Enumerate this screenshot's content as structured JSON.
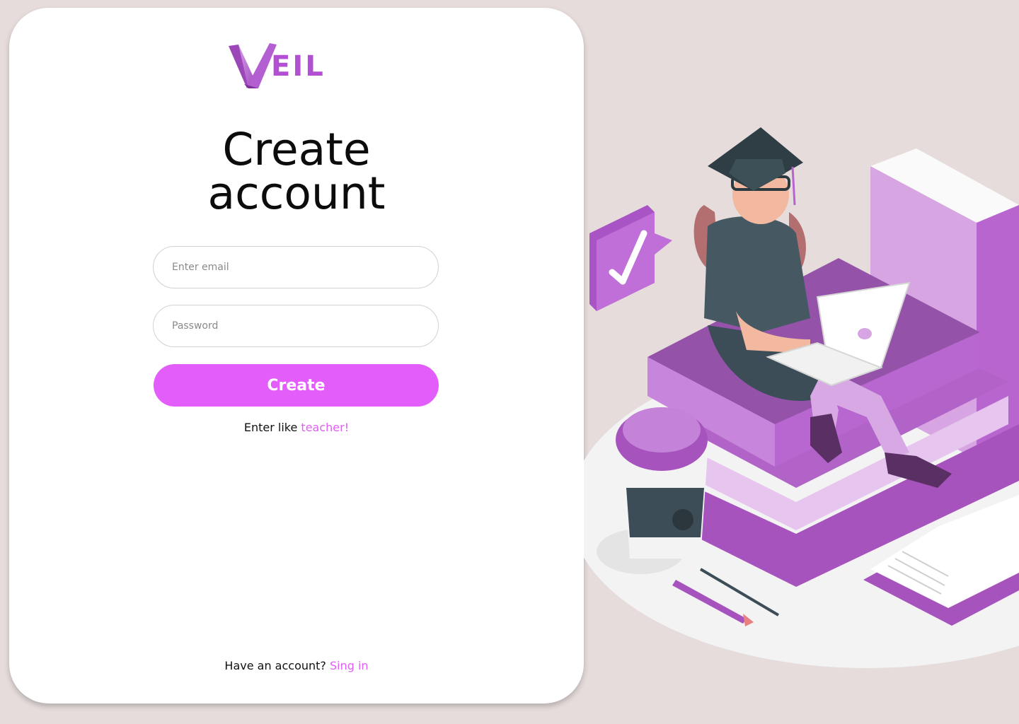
{
  "brand": {
    "logo_text": "EIL",
    "logo_mark": "V"
  },
  "heading": {
    "line1": "Create",
    "line2": "account"
  },
  "form": {
    "email_placeholder": "Enter email",
    "password_placeholder": "Password",
    "submit_label": "Create"
  },
  "alt_login": {
    "prefix": "Enter like ",
    "link": "teacher!"
  },
  "footer": {
    "prefix": "Have an account? ",
    "link": "Sing in"
  },
  "colors": {
    "accent": "#e35dfa",
    "link": "#df5ff5",
    "brand_purple": "#b24fd3",
    "background": "#e6dcdc"
  },
  "illustration": {
    "icon": "graduate-with-laptop-on-books"
  }
}
